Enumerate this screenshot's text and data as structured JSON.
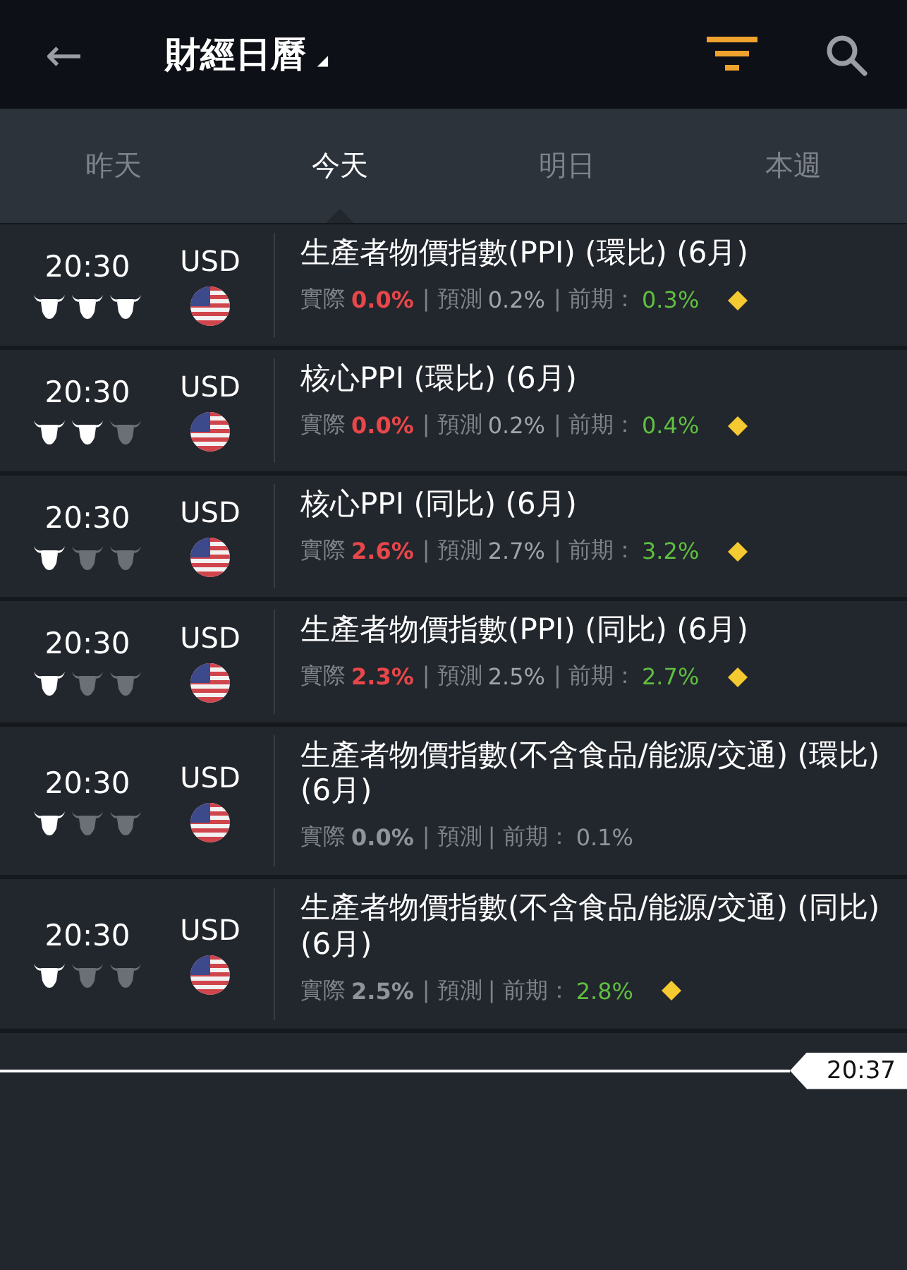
{
  "header": {
    "back": "←",
    "title": "財經日曆",
    "title_caret": "◢"
  },
  "tabs": [
    {
      "label": "昨天",
      "selected": false
    },
    {
      "label": "今天",
      "selected": true
    },
    {
      "label": "明日",
      "selected": false
    },
    {
      "label": "本週",
      "selected": false
    }
  ],
  "events": [
    {
      "time": "20:30",
      "currency": "USD",
      "stars": 3,
      "title": "生產者物價指數(PPI) (環比) (6月)",
      "actual_label": "實際",
      "actual": {
        "text": "0.0%",
        "color": "#e8474a"
      },
      "forecast_label": "| 預測",
      "forecast": "0.2%",
      "previous_label": "| 前期：",
      "previous": {
        "text": "0.3%",
        "color": "#5fbf3f"
      },
      "alert": true
    },
    {
      "time": "20:30",
      "currency": "USD",
      "stars": 2,
      "title": "核心PPI (環比) (6月)",
      "actual_label": "實際",
      "actual": {
        "text": "0.0%",
        "color": "#e8474a"
      },
      "forecast_label": "| 預測",
      "forecast": "0.2%",
      "previous_label": "| 前期：",
      "previous": {
        "text": "0.4%",
        "color": "#5fbf3f"
      },
      "alert": true
    },
    {
      "time": "20:30",
      "currency": "USD",
      "stars": 1,
      "title": "核心PPI (同比) (6月)",
      "actual_label": "實際",
      "actual": {
        "text": "2.6%",
        "color": "#e8474a"
      },
      "forecast_label": "| 預測",
      "forecast": "2.7%",
      "previous_label": "| 前期：",
      "previous": {
        "text": "3.2%",
        "color": "#5fbf3f"
      },
      "alert": true
    },
    {
      "time": "20:30",
      "currency": "USD",
      "stars": 1,
      "title": "生產者物價指數(PPI) (同比) (6月)",
      "actual_label": "實際",
      "actual": {
        "text": "2.3%",
        "color": "#e8474a"
      },
      "forecast_label": "| 預測",
      "forecast": "2.5%",
      "previous_label": "| 前期：",
      "previous": {
        "text": "2.7%",
        "color": "#5fbf3f"
      },
      "alert": true
    },
    {
      "time": "20:30",
      "currency": "USD",
      "stars": 1,
      "title": "生產者物價指數(不含食品/能源/交通) (環比) (6月)",
      "actual_label": "實際",
      "actual": {
        "text": "0.0%",
        "color": "#8f949a"
      },
      "forecast_label": "| 預測",
      "previous_label": "| 前期：",
      "previous": {
        "text": "0.1%",
        "color": "#8f949a"
      },
      "alert": false
    },
    {
      "time": "20:30",
      "currency": "USD",
      "stars": 1,
      "title": "生產者物價指數(不含食品/能源/交通) (同比) (6月)",
      "actual_label": "實際",
      "actual": {
        "text": "2.5%",
        "color": "#8f949a"
      },
      "forecast_label": "| 預測",
      "previous_label": "| 前期：",
      "previous": {
        "text": "2.8%",
        "color": "#5fbf3f"
      },
      "alert": true
    }
  ],
  "now_marker": "20:37"
}
